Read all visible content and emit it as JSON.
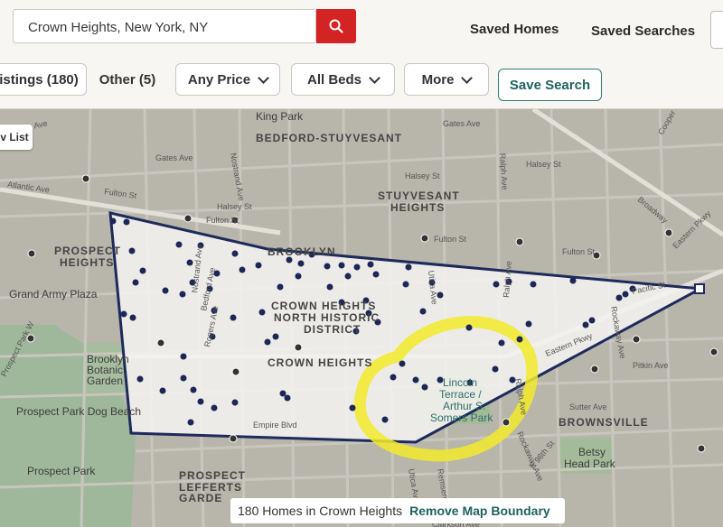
{
  "search": {
    "value": "Crown Heights, New York, NY"
  },
  "header": {
    "saved_homes": "Saved Homes",
    "saved_searches": "Saved Searches"
  },
  "filters": {
    "listings": "istings (180)",
    "other": "Other (5)",
    "price": "Any Price",
    "beds": "All Beds",
    "more": "More",
    "save_search": "Save Search"
  },
  "list_toggle": "v List",
  "map": {
    "labels": {
      "bedford_stuyvesant": "BEDFORD-STUYVESANT",
      "stuyvesant_heights_1": "STUYVESANT",
      "stuyvesant_heights_2": "HEIGHTS",
      "prospect_heights_1": "PROSPECT",
      "prospect_heights_2": "HEIGHTS",
      "brooklyn": "BROOKLYN",
      "grand_army_plaza": "Grand Army Plaza",
      "chnhd_1": "CROWN HEIGHTS",
      "chnhd_2": "NORTH HISTORIC",
      "chnhd_3": "DISTRICT",
      "crown_heights": "CROWN HEIGHTS",
      "brooklyn_botanic_1": "Brooklyn",
      "brooklyn_botanic_2": "Botanic",
      "brooklyn_botanic_3": "Garden",
      "dog_beach": "Prospect Park Dog Beach",
      "prospect_park": "Prospect Park",
      "prospect_lefferts_1": "PROSPECT",
      "prospect_lefferts_2": "LEFFERTS",
      "prospect_lefferts_3": "GARDE",
      "lincoln_1": "Lincoln",
      "lincoln_2": "Terrace /",
      "lincoln_3": "Arthur S.",
      "lincoln_4": "Somers Park",
      "brownsville": "BROWNSVILLE",
      "betsy_1": "Betsy",
      "betsy_2": "Head Park",
      "king_park": "King Park"
    },
    "streets": {
      "gates_ave_1": "Gates Ave",
      "gates_ave_2": "Gates Ave",
      "fulton_st_1": "Fulton St",
      "fulton_st_2": "Fulton St",
      "fulton_st_3": "Fulton St",
      "fulton_st_4": "Fulton St",
      "halsey_st_1": "Halsey St",
      "halsey_st_2": "Halsey St",
      "halsey_st_3": "Halsey St",
      "atlantic_ave": "Atlantic Ave",
      "nostrand_ave_1": "Nostrand Ave",
      "nostrand_ave_2": "Nostrand Ave",
      "ralph_ave_1": "Ralph Ave",
      "ralph_ave_2": "Ralph Ave",
      "ralph_ave_3": "Ralph Ave",
      "bedford_ave": "Bedford Ave",
      "rogers_ave": "Rogers Ave",
      "utica_ave_1": "Utica Ave",
      "utica_ave_2": "Utica Ave",
      "eastern_pkwy": "Eastern Pkwy",
      "eastern_pkwy_2": "Eastern Pkwy",
      "rockaway_ave_1": "Rockaway Ave",
      "rockaway_ave_2": "Rockaway Ave",
      "pitkin_ave": "Pitkin Ave",
      "sutter_ave": "Sutter Ave",
      "empire_blvd": "Empire Blvd",
      "remsen_ave": "Remsen Ave",
      "e_98th_st": "E 98th St",
      "broadway": "Broadway",
      "cooper_st": "Cooper St",
      "pacific_st": "Pacific St",
      "prospect_park_w": "Prospect Park W",
      "fayette_ave": "ayette Ave",
      "clarkson_ave": "Clarkson Ave"
    },
    "boundary_color": "#1d2a5c",
    "marker_color": "#1b2757",
    "highlight_color": "#f2ea2a"
  },
  "results": {
    "count_text": "180 Homes in Crown Heights",
    "remove_label": "Remove Map Boundary"
  }
}
